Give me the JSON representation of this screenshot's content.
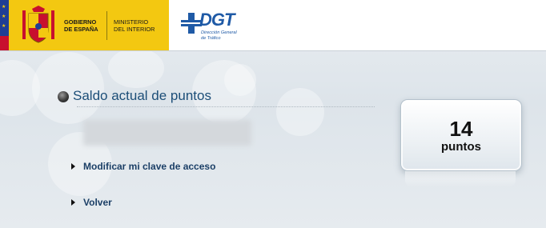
{
  "header": {
    "gov_name": "GOBIERNO\nDE ESPAÑA",
    "ministry_name": "MINISTERIO\nDEL INTERIOR",
    "dgt_name": "DGT",
    "dgt_subtitle": "Dirección General\nde Tráfico"
  },
  "main": {
    "section_title": "Saldo actual de puntos",
    "links": {
      "modify_key": "Modificar mi clave de acceso",
      "back": "Volver"
    }
  },
  "points": {
    "value": "14",
    "unit": "puntos"
  },
  "colors": {
    "gov_yellow": "#f3c811",
    "eu_blue": "#1f3e95",
    "dgt_blue": "#1f5aa6",
    "title_blue": "#1c4e78",
    "link_blue": "#1b3f66"
  },
  "icons": {
    "section_bullet": "black-circle-bullet-icon",
    "link_arrow": "triangle-right-icon"
  }
}
